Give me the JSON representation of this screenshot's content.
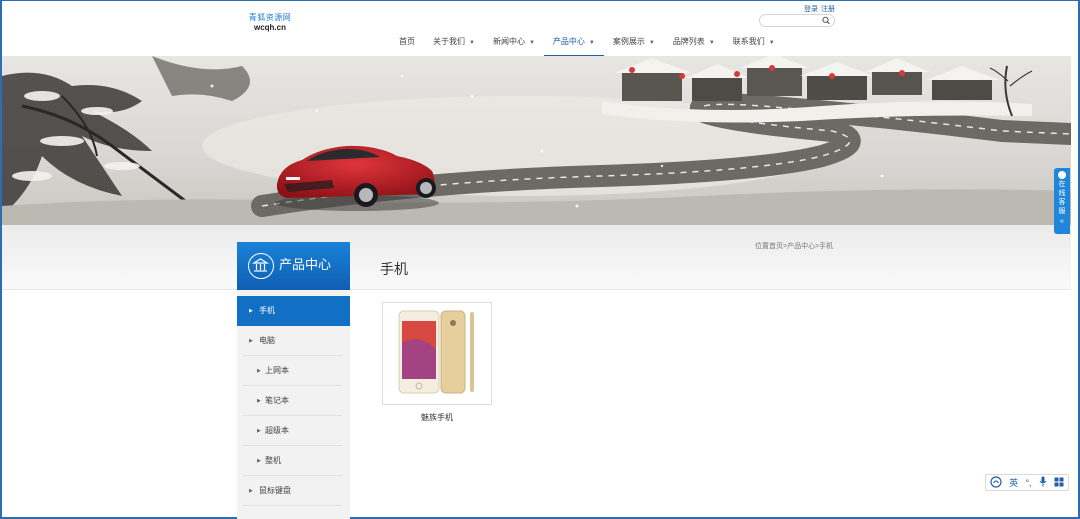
{
  "header": {
    "logo_cn": "青狐资源网",
    "logo_en": "wcqh.cn",
    "login": "登录",
    "register": "注册",
    "search_placeholder": ""
  },
  "nav": [
    {
      "label": "首页",
      "dropdown": false
    },
    {
      "label": "关于我们",
      "dropdown": true
    },
    {
      "label": "新闻中心",
      "dropdown": true
    },
    {
      "label": "产品中心",
      "dropdown": true,
      "active": true
    },
    {
      "label": "案例展示",
      "dropdown": true
    },
    {
      "label": "品牌列表",
      "dropdown": true
    },
    {
      "label": "联系我们",
      "dropdown": true
    }
  ],
  "sidebar": {
    "title": "产品中心",
    "items": [
      {
        "label": "手机",
        "active": true
      },
      {
        "label": "电脑"
      },
      {
        "label": "上网本"
      },
      {
        "label": "笔记本"
      },
      {
        "label": "超级本"
      },
      {
        "label": "整机"
      },
      {
        "label": "鼠标键盘"
      }
    ]
  },
  "page": {
    "title": "手机",
    "breadcrumb": "位置首页>产品中心>手机"
  },
  "products": [
    {
      "name": "魅族手机"
    }
  ],
  "service": {
    "label": "在线客服",
    "close": "«"
  },
  "ime": {
    "lang": "英"
  },
  "colors": {
    "accent": "#1270c4",
    "link": "#1f5fa8",
    "car": "#c41e24"
  }
}
